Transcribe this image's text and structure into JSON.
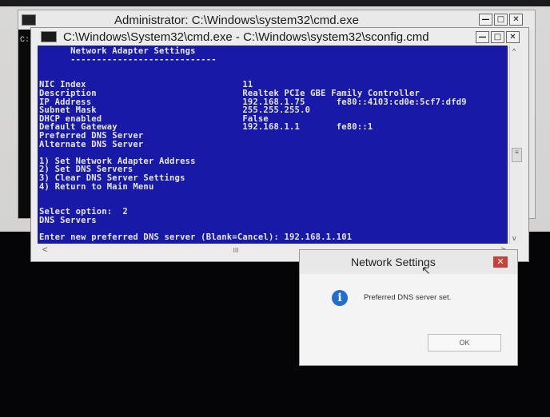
{
  "back_window": {
    "title": "Administrator: C:\\Windows\\system32\\cmd.exe",
    "left_text": "C:",
    "controls": [
      "—",
      "□",
      "✕"
    ]
  },
  "front_window": {
    "title": "C:\\Windows\\System32\\cmd.exe - C:\\Windows\\system32\\sconfig.cmd",
    "controls": [
      "—",
      "□",
      "✕"
    ],
    "console_lines": [
      "      Network Adapter Settings",
      "      ----------------------------",
      "",
      "",
      "NIC Index                              11",
      "Description                            Realtek PCIe GBE Family Controller",
      "IP Address                             192.168.1.75      fe80::4103:cd0e:5cf7:dfd9",
      "Subnet Mask                            255.255.255.0",
      "DHCP enabled                           False",
      "Default Gateway                        192.168.1.1       fe80::1",
      "Preferred DNS Server",
      "Alternate DNS Server",
      "",
      "1) Set Network Adapter Address",
      "2) Set DNS Servers",
      "3) Clear DNS Server Settings",
      "4) Return to Main Menu",
      "",
      "",
      "Select option:  2",
      "DNS Servers",
      "",
      "Enter new preferred DNS server (Blank=Cancel): 192.168.1.101"
    ],
    "scrollbar": {
      "up": "^",
      "down": "v",
      "thumb": "≡",
      "left": "<",
      "right": ">",
      "hthumb": "III"
    }
  },
  "dialog": {
    "title": "Network Settings",
    "close": "✕",
    "info_glyph": "i",
    "message": "Preferred DNS server set.",
    "ok_label": "OK",
    "cursor_glyph": "↖"
  }
}
